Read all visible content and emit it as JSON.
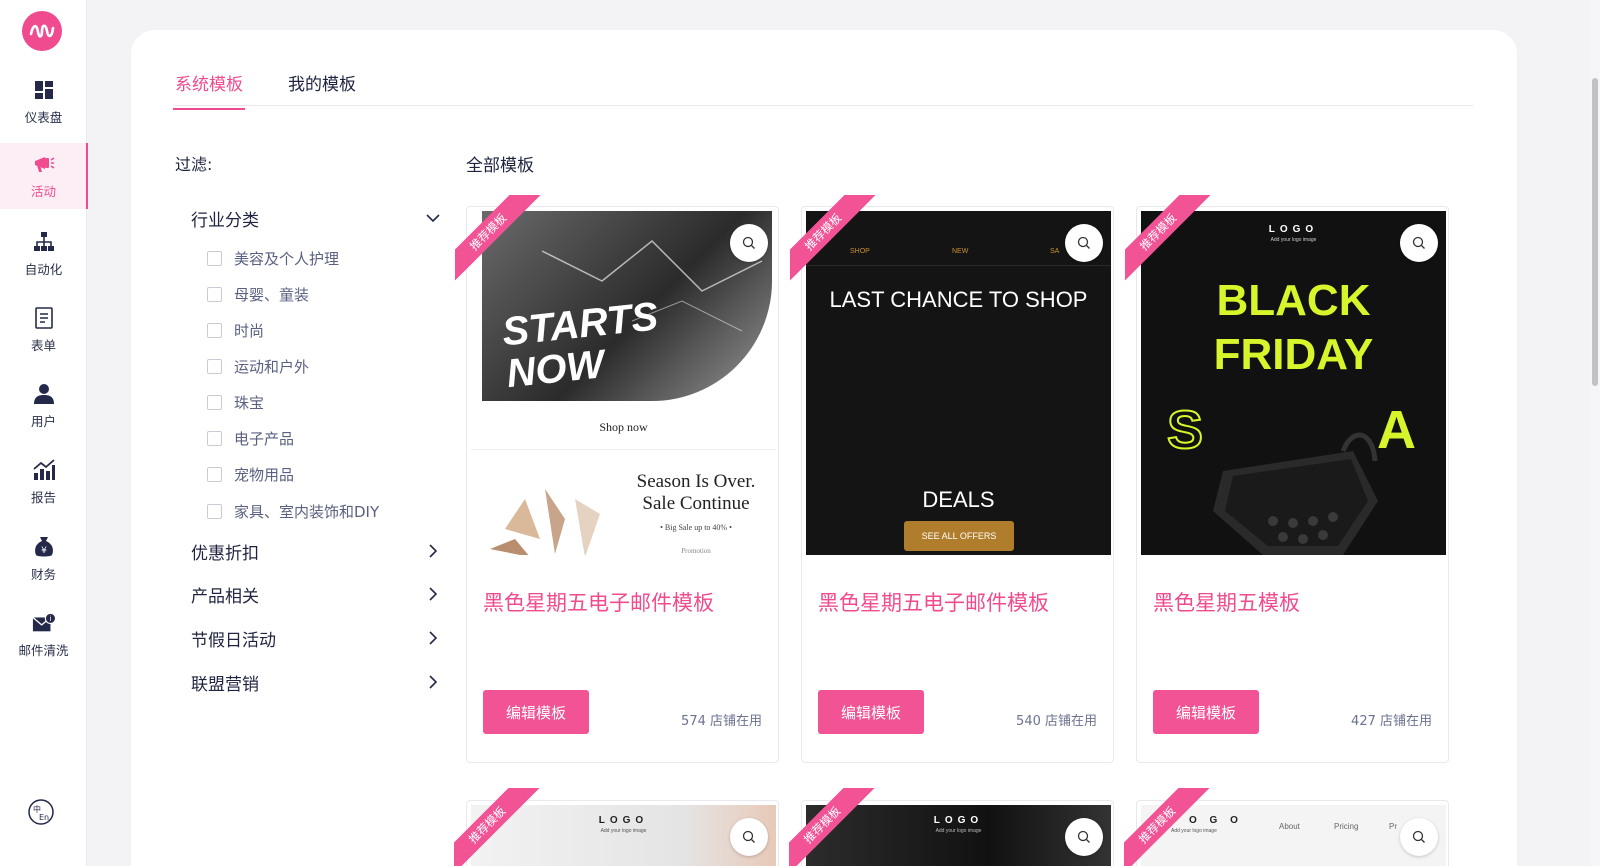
{
  "sidebar": {
    "items": [
      {
        "label": "仪表盘",
        "icon": "dashboard-icon"
      },
      {
        "label": "活动",
        "icon": "megaphone-icon"
      },
      {
        "label": "自动化",
        "icon": "automation-icon"
      },
      {
        "label": "表单",
        "icon": "form-icon"
      },
      {
        "label": "用户",
        "icon": "user-icon"
      },
      {
        "label": "报告",
        "icon": "report-icon"
      },
      {
        "label": "财务",
        "icon": "finance-icon"
      },
      {
        "label": "邮件清洗",
        "icon": "mail-clean-icon"
      }
    ],
    "lang_icon": "language-switch-icon"
  },
  "tabs": [
    {
      "label": "系统模板",
      "active": true
    },
    {
      "label": "我的模板",
      "active": false
    }
  ],
  "filter": {
    "title": "过滤:",
    "categories": [
      {
        "label": "行业分类",
        "expanded": true,
        "options": [
          "美容及个人护理",
          "母婴、童装",
          "时尚",
          "运动和户外",
          "珠宝",
          "电子产品",
          "宠物用品",
          "家具、室内装饰和DIY"
        ]
      },
      {
        "label": "优惠折扣",
        "expanded": false
      },
      {
        "label": "产品相关",
        "expanded": false
      },
      {
        "label": "节假日活动",
        "expanded": false
      },
      {
        "label": "联盟营销",
        "expanded": false
      }
    ]
  },
  "templates": {
    "title": "全部模板",
    "ribbon": "推荐模板",
    "edit_label": "编辑模板",
    "items": [
      {
        "name": "黑色星期五电子邮件模板",
        "usage": "574 店铺在用",
        "preview": {
          "headline": "STARTS NOW",
          "cta": "Shop now",
          "subhead1": "Season Is Over.",
          "subhead2": "Sale Continue",
          "note": "• Big Sale up to 40% •",
          "note2": "Promotion"
        }
      },
      {
        "name": "黑色星期五电子邮件模板",
        "usage": "540 店铺在用",
        "preview": {
          "nav": [
            "SHOP",
            "NEW",
            "SA"
          ],
          "headline": "LAST CHANCE TO SHOP",
          "deals": "DEALS",
          "cta": "SEE ALL OFFERS"
        }
      },
      {
        "name": "黑色星期五模板",
        "usage": "427 店铺在用",
        "preview": {
          "logo": "LOGO",
          "logo_sub": "Add your logo image",
          "line1": "BLACK",
          "line2": "FRIDAY",
          "s": "S",
          "a": "A"
        }
      }
    ],
    "second_row": [
      {
        "logo": "LOGO",
        "logo_sub": "Add your logo image"
      },
      {
        "logo": "LOGO",
        "logo_sub": "Add your logo image"
      },
      {
        "logo": "O G O",
        "logo_sub": "Add your logo image",
        "nav": [
          "About",
          "Pricing",
          "Pr"
        ]
      }
    ]
  },
  "colors": {
    "accent": "#f04b8f",
    "button": "#f25394",
    "lime": "#d7f52a",
    "gold": "#b07d2c"
  }
}
